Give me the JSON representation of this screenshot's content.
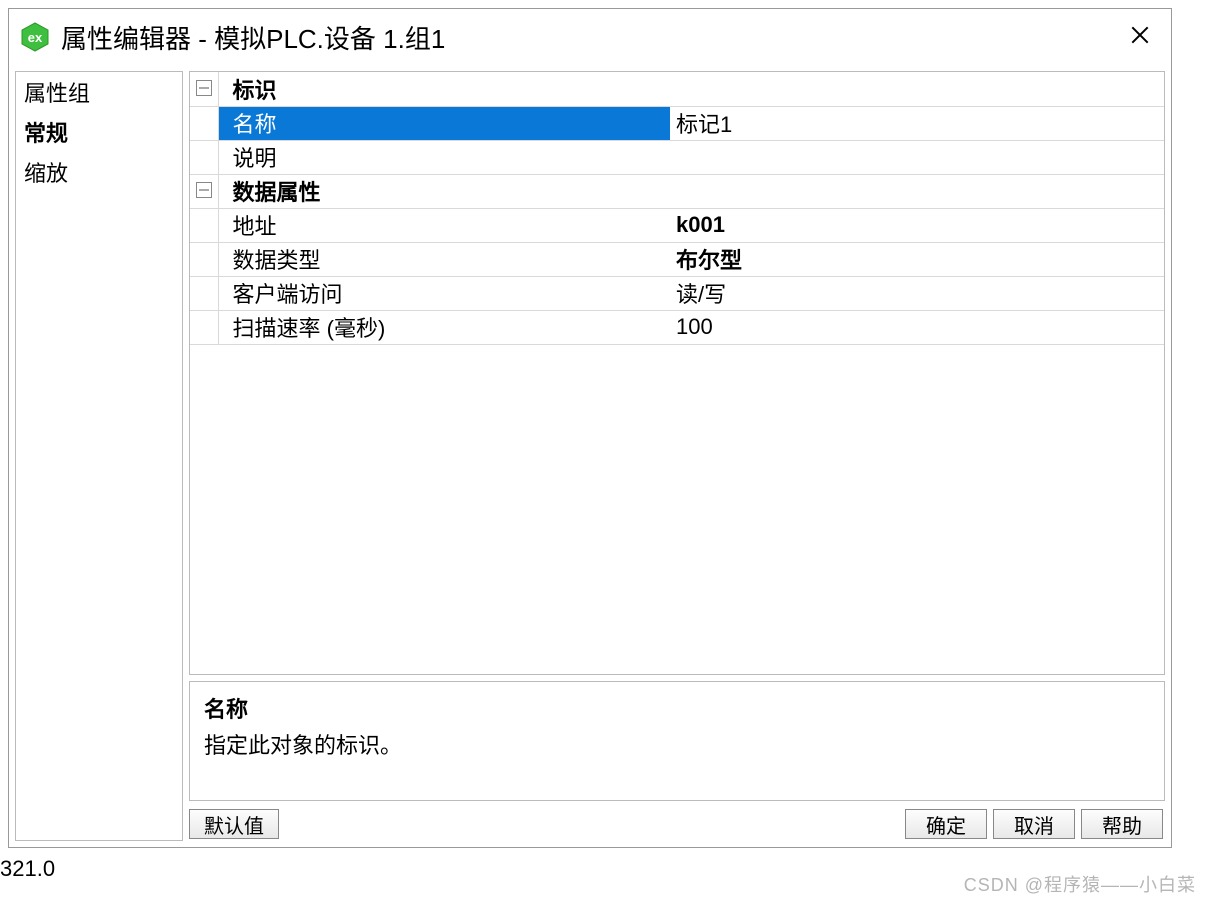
{
  "window": {
    "title": "属性编辑器 - 模拟PLC.设备 1.组1"
  },
  "sidebar": {
    "header": "属性组",
    "items": [
      "常规",
      "缩放"
    ],
    "selected_index": 0
  },
  "groups": [
    {
      "name": "标识",
      "rows": [
        {
          "key": "名称",
          "value": "标记1",
          "selected": true,
          "bold": false
        },
        {
          "key": "说明",
          "value": "",
          "bold": false
        }
      ]
    },
    {
      "name": "数据属性",
      "rows": [
        {
          "key": "地址",
          "value": "k001",
          "bold": true
        },
        {
          "key": "数据类型",
          "value": "布尔型",
          "bold": true
        },
        {
          "key": "客户端访问",
          "value": "读/写",
          "bold": false
        },
        {
          "key": "扫描速率 (毫秒)",
          "value": "100",
          "bold": false
        }
      ]
    }
  ],
  "description": {
    "title": "名称",
    "text": "指定此对象的标识。"
  },
  "buttons": {
    "defaults": "默认值",
    "ok": "确定",
    "cancel": "取消",
    "help": "帮助"
  },
  "status": "321.0",
  "watermark": "CSDN @程序猿——小白菜"
}
